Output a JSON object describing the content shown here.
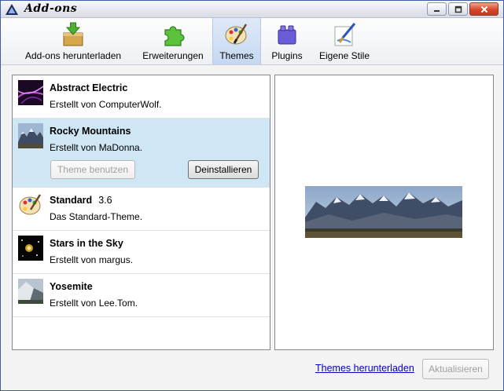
{
  "window": {
    "title": "Add-ons",
    "caption_buttons": [
      "minimize-icon",
      "restore-icon",
      "close-icon"
    ]
  },
  "toolbar": {
    "tabs": [
      {
        "label": "Add-ons herunterladen",
        "icon": "download-package-icon",
        "selected": false
      },
      {
        "label": "Erweiterungen",
        "icon": "puzzle-piece-icon",
        "selected": false
      },
      {
        "label": "Themes",
        "icon": "palette-icon",
        "selected": true
      },
      {
        "label": "Plugins",
        "icon": "plugin-block-icon",
        "selected": false
      },
      {
        "label": "Eigene Stile",
        "icon": "paint-brush-icon",
        "selected": false
      }
    ]
  },
  "themes": [
    {
      "name": "Abstract Electric",
      "version": "",
      "desc": "Erstellt von ComputerWolf.",
      "thumb": "abstract-electric-thumbnail"
    },
    {
      "name": "Rocky Mountains",
      "version": "",
      "desc": "Erstellt von MaDonna.",
      "thumb": "rocky-mountains-thumbnail",
      "selected": true,
      "actions": {
        "use": "Theme benutzen",
        "uninstall": "Deinstallieren"
      }
    },
    {
      "name": "Standard",
      "version": "3.6",
      "desc": "Das Standard-Theme.",
      "thumb": "standard-palette-thumbnail"
    },
    {
      "name": "Stars in the Sky",
      "version": "",
      "desc": "Erstellt von margus.",
      "thumb": "stars-thumbnail"
    },
    {
      "name": "Yosemite",
      "version": "",
      "desc": "Erstellt von Lee.Tom.",
      "thumb": "yosemite-thumbnail"
    }
  ],
  "preview": {
    "image": "rocky-mountains-preview"
  },
  "footer": {
    "download_link": "Themes herunterladen",
    "update_button": "Aktualisieren"
  },
  "colors": {
    "selection": "#cfe6f4",
    "link": "#0000cc",
    "title_bar": "#e4e6ee"
  }
}
